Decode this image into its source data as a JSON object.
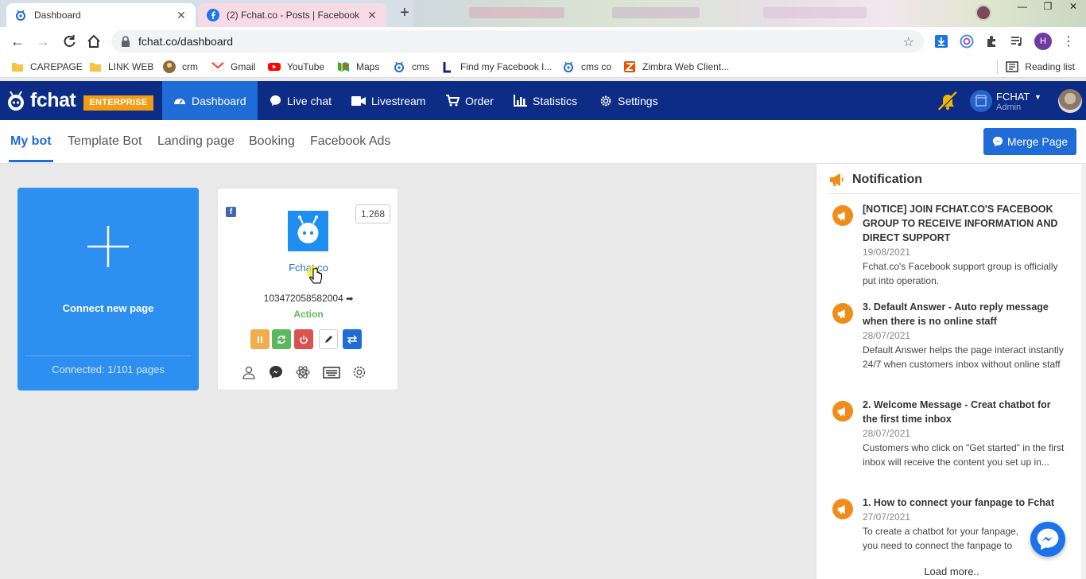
{
  "browser": {
    "tabs": [
      {
        "title": "Dashboard",
        "active": true
      },
      {
        "title": "(2) Fchat.co - Posts | Facebook",
        "active": false
      }
    ],
    "url": "fchat.co/dashboard",
    "profile_initial": "H",
    "bookmarks": [
      {
        "label": "CAREPAGE",
        "icon": "folder-icon"
      },
      {
        "label": "LINK WEB",
        "icon": "folder-icon"
      },
      {
        "label": "crm",
        "icon": "crm-icon"
      },
      {
        "label": "Gmail",
        "icon": "gmail-icon"
      },
      {
        "label": "YouTube",
        "icon": "youtube-icon"
      },
      {
        "label": "Maps",
        "icon": "maps-icon"
      },
      {
        "label": "cms",
        "icon": "fchat-icon"
      },
      {
        "label": "Find my Facebook I...",
        "icon": "l-icon"
      },
      {
        "label": "cms co",
        "icon": "fchat-icon"
      },
      {
        "label": "Zimbra Web Client...",
        "icon": "zimbra-icon"
      }
    ],
    "reading_list": "Reading list"
  },
  "app": {
    "brand": "fchat",
    "edition": "ENTERPRISE",
    "menu": [
      {
        "label": "Dashboard",
        "icon": "dashboard-icon",
        "active": true
      },
      {
        "label": "Live chat",
        "icon": "chat-icon",
        "active": false
      },
      {
        "label": "Livestream",
        "icon": "video-icon",
        "active": false
      },
      {
        "label": "Order",
        "icon": "cart-icon",
        "active": false
      },
      {
        "label": "Statistics",
        "icon": "chart-icon",
        "active": false
      },
      {
        "label": "Settings",
        "icon": "gear-icon",
        "active": false
      }
    ],
    "account": {
      "name": "FCHAT",
      "role": "Admin"
    }
  },
  "subnav": {
    "tabs": [
      "My bot",
      "Template Bot",
      "Landing page",
      "Booking",
      "Facebook Ads"
    ],
    "active": "My bot",
    "merge_button": "Merge Page"
  },
  "connect_card": {
    "label": "Connect new page",
    "connected": "Connected: 1/101 pages"
  },
  "bot_card": {
    "count": "1.268",
    "name": "Fchat.co",
    "page_id": "103472058582004",
    "status": "Action"
  },
  "notifications": {
    "title": "Notification",
    "items": [
      {
        "title": "[NOTICE] JOIN FCHAT.CO'S FACEBOOK GROUP TO RECEIVE INFORMATION AND DIRECT SUPPORT",
        "date": "19/08/2021",
        "body": "Fchat.co's Facebook support group is officially put into operation."
      },
      {
        "title": "3. Default Answer - Auto reply message when there is no online staff",
        "date": "28/07/2021",
        "body": "Default Answer helps the page interact instantly 24/7 when customers inbox without online staff"
      },
      {
        "title": "2. Welcome Message - Creat chatbot for the first time inbox",
        "date": "28/07/2021",
        "body": "Customers who click on \"Get started\" in the first inbox will receive the content you set up in..."
      },
      {
        "title": "1. How to connect your fanpage to Fchat",
        "date": "27/07/2021",
        "body": "To create a chatbot for your fanpage, you need to connect the fanpage to"
      }
    ],
    "load_more": "Load more.."
  },
  "colors": {
    "navbar": "#0c2c86",
    "accent": "#1f6cd6",
    "connect_card": "#2d8ff0",
    "notification_icon": "#f08c1a",
    "status_green": "#5cb85c"
  }
}
